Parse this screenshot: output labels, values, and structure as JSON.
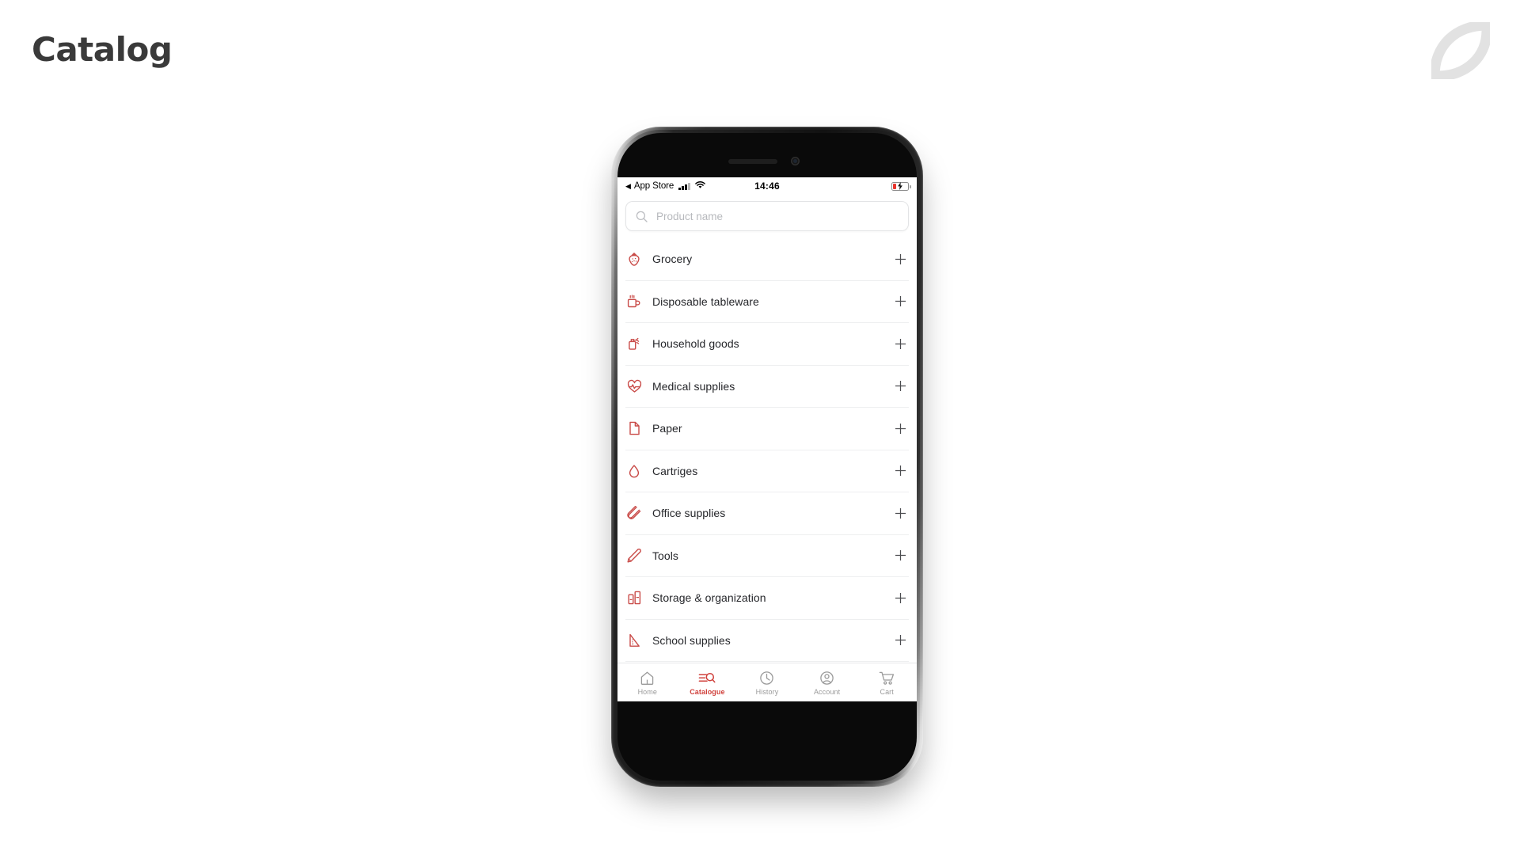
{
  "page": {
    "title": "Catalog",
    "background": "#ffffff",
    "title_color": "#3a3a3a"
  },
  "brand": {
    "logo_icon": "leaf-logo-icon",
    "logo_color": "#e0e0e0"
  },
  "phone": {
    "status_bar": {
      "back_arrow": "◀",
      "carrier_label": "App Store",
      "signal_icon": "cellular-signal-icon",
      "wifi_icon": "wifi-icon",
      "time": "14:46",
      "battery_icon": "battery-charging-low-icon",
      "battery_color": "#e8352e"
    },
    "search": {
      "icon": "search-icon",
      "value": "",
      "placeholder": "Product name"
    },
    "categories": [
      {
        "label": "Grocery",
        "icon": "strawberry-icon",
        "action": "+"
      },
      {
        "label": "Disposable tableware",
        "icon": "coffee-cup-icon",
        "action": "+"
      },
      {
        "label": "Household goods",
        "icon": "spray-bottle-icon",
        "action": "+"
      },
      {
        "label": "Medical supplies",
        "icon": "heart-pulse-icon",
        "action": "+"
      },
      {
        "label": "Paper",
        "icon": "document-icon",
        "action": "+"
      },
      {
        "label": "Cartriges",
        "icon": "ink-drop-icon",
        "action": "+"
      },
      {
        "label": "Office supplies",
        "icon": "paperclip-icon",
        "action": "+"
      },
      {
        "label": "Tools",
        "icon": "pencil-icon",
        "action": "+"
      },
      {
        "label": "Storage & organization",
        "icon": "storage-boxes-icon",
        "action": "+"
      },
      {
        "label": "School supplies",
        "icon": "set-square-icon",
        "action": "+"
      }
    ],
    "tabs": [
      {
        "label": "Home",
        "icon": "home-icon",
        "active": false
      },
      {
        "label": "Catalogue",
        "icon": "catalog-search-icon",
        "active": true
      },
      {
        "label": "History",
        "icon": "clock-icon",
        "active": false
      },
      {
        "label": "Account",
        "icon": "user-circle-icon",
        "active": false
      },
      {
        "label": "Cart",
        "icon": "shopping-cart-icon",
        "active": false
      }
    ],
    "theme": {
      "accent": "#d0413c",
      "icon_red": "#c94b48",
      "text": "#25262a",
      "muted": "#9a9a9a",
      "divider": "#eeeff0"
    }
  }
}
